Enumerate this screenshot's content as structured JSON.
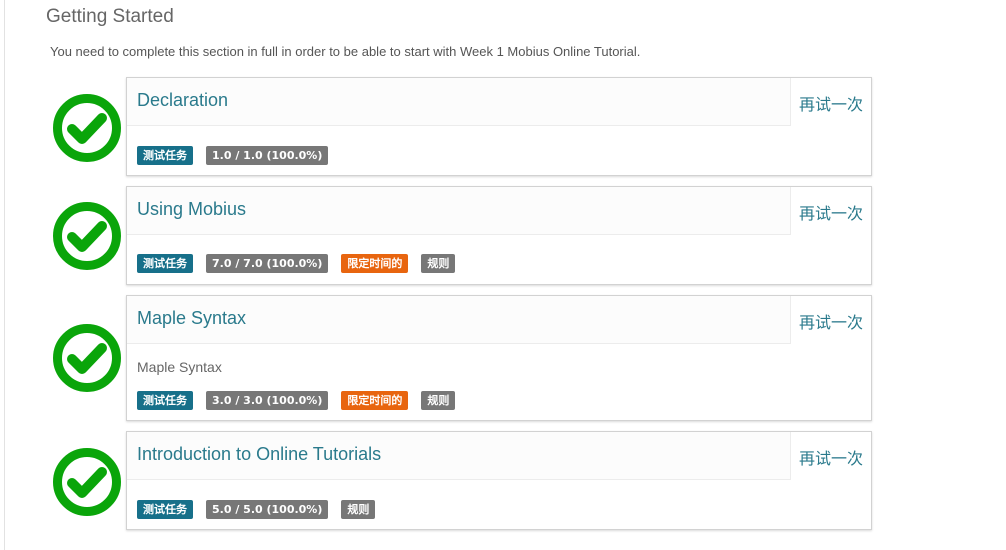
{
  "section": {
    "title": "Getting Started",
    "description": "You need to complete this section in full in order to be able to start with Week 1 Mobius Online Tutorial."
  },
  "colors": {
    "check_green": "#0aa50a",
    "link_teal": "#2a7a8c",
    "badge_blue": "#17708a",
    "badge_gray": "#777777",
    "badge_orange": "#e8650f"
  },
  "items": [
    {
      "title": "Declaration",
      "retry_label": "再试一次",
      "description": "",
      "badges": {
        "type": "测试任务",
        "score": "1.0 / 1.0 (100.0%)",
        "timed": "",
        "rules": ""
      }
    },
    {
      "title": "Using Mobius",
      "retry_label": "再试一次",
      "description": "",
      "badges": {
        "type": "测试任务",
        "score": "7.0 / 7.0 (100.0%)",
        "timed": "限定时间的",
        "rules": "规则"
      }
    },
    {
      "title": "Maple Syntax",
      "retry_label": "再试一次",
      "description": "Maple Syntax",
      "badges": {
        "type": "测试任务",
        "score": "3.0 / 3.0 (100.0%)",
        "timed": "限定时间的",
        "rules": "规则"
      }
    },
    {
      "title": "Introduction to Online Tutorials",
      "retry_label": "再试一次",
      "description": "",
      "badges": {
        "type": "测试任务",
        "score": "5.0 / 5.0 (100.0%)",
        "timed": "",
        "rules": "规则"
      }
    }
  ]
}
